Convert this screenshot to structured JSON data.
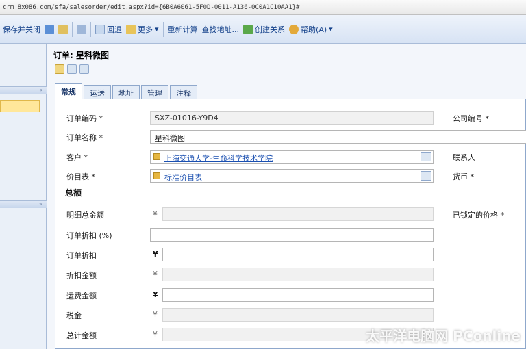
{
  "browser": {
    "url": "crm 8x086.com/sfa/salesorder/edit.aspx?id={6B0A6061-5F0D-0011-A136-0C0A1C10AA1}#"
  },
  "toolbar": {
    "save_close_label": "保存并关闭",
    "recalc_label": "回退",
    "actions_label": "更多",
    "send_label": "重新计算",
    "lookup_address_label": "查找地址...",
    "create_relation_label": "创建关系",
    "help_label": "帮助(A)"
  },
  "form": {
    "title": "订单: 星科微图",
    "tabs": [
      "常规",
      "运送",
      "地址",
      "管理",
      "注释"
    ],
    "active_tab": 0,
    "fields": {
      "order_id_label": "订单编码 *",
      "order_id_value": "SXZ-01016-Y9D4",
      "name_label": "订单名称 *",
      "name_value": "星科微图",
      "customer_label": "客户 *",
      "customer_value": "上海交通大学-生命科学技术学院",
      "pricelist_label": "价目表 *",
      "pricelist_value": "标准价目表",
      "currency_label": "公司编号 *",
      "contact_label": "联系人",
      "owner_label": "货币 *",
      "locked_price_label": "已锁定的价格 *"
    },
    "totals_section": "总额",
    "totals": [
      {
        "label": "明细总金额",
        "symbol": "¥",
        "readonly": true
      },
      {
        "label": "订单折扣 (%)",
        "symbol": "",
        "readonly": false
      },
      {
        "label": "订单折扣",
        "symbol": "¥",
        "readonly": false
      },
      {
        "label": "折扣金额",
        "symbol": "¥",
        "readonly": true
      },
      {
        "label": "运费金额",
        "symbol": "¥",
        "readonly": false
      },
      {
        "label": "税金",
        "symbol": "¥",
        "readonly": true
      },
      {
        "label": "总计金额",
        "symbol": "¥",
        "readonly": true
      }
    ]
  },
  "watermark": "太平洋电脑网 PConline",
  "colors": {
    "toolbar_bg": "#d7e3f4",
    "accent": "#15428b",
    "link": "#1a4fb0",
    "selected": "#ffe79a"
  }
}
